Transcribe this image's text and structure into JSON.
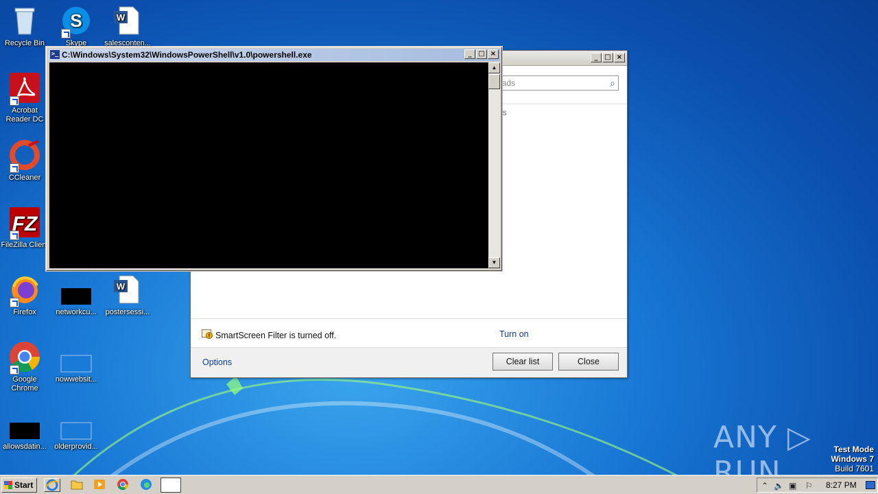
{
  "desktop": {
    "icons": [
      {
        "label": "Recycle Bin"
      },
      {
        "label": "Skype"
      },
      {
        "label": "salesconten..."
      },
      {
        "label": "Acrobat Reader DC"
      },
      {
        "label": "CCleaner"
      },
      {
        "label": "FileZilla Client"
      },
      {
        "label": "Firefox"
      },
      {
        "label": "networkcu..."
      },
      {
        "label": "postersessi..."
      },
      {
        "label": "Google Chrome"
      },
      {
        "label": "nowwebsit..."
      },
      {
        "label": "allowsdatin..."
      },
      {
        "label": "olderprovid..."
      }
    ]
  },
  "powershell": {
    "title": "C:\\Windows\\System32\\WindowsPowerShell\\v1.0\\powershell.exe",
    "min": "_",
    "max": "□",
    "close": "×"
  },
  "downloads": {
    "search_placeholder": "oads",
    "column_text": "ns",
    "smartscreen_text": "SmartScreen Filter is turned off.",
    "turn_on": "Turn on",
    "options": "Options",
    "clear_list": "Clear list",
    "close": "Close"
  },
  "taskbar": {
    "start": "Start",
    "clock": "8:27 PM"
  },
  "watermark": {
    "brand": "ANY ▷ RUN",
    "test_mode": "Test Mode",
    "os": "Windows 7",
    "build": "Build 7601"
  },
  "colors": {
    "accent_link": "#0a3aa8",
    "desktop_blue": "#1877d4",
    "console_bg": "#000000"
  }
}
